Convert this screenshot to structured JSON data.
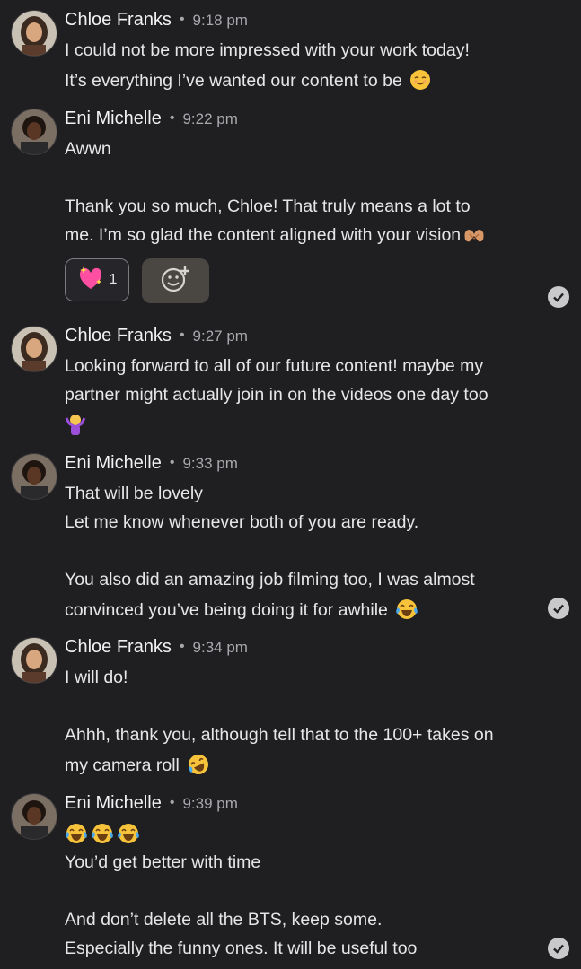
{
  "messages": [
    {
      "sender": "Chloe Franks",
      "time": "9:18 pm",
      "lines": [
        "I could not be more impressed with your work today!",
        "It’s everything I’ve wanted our content to be"
      ],
      "emoji": "relieved-face",
      "read": false
    },
    {
      "sender": "Eni Michelle",
      "time": "9:22 pm",
      "lines": [
        "Awwn",
        "",
        "Thank you so much, Chloe! That truly means a lot to",
        "me. I’m so glad the content aligned with your vision"
      ],
      "emoji": "heart-hands",
      "reaction": {
        "emoji": "sparkling-heart",
        "count": "1"
      },
      "read": true
    },
    {
      "sender": "Chloe Franks",
      "time": "9:27 pm",
      "lines": [
        "Looking forward to all of our future content! maybe my",
        "partner might actually join in on the videos one day too"
      ],
      "emoji": "person-shrugging",
      "read": false
    },
    {
      "sender": "Eni Michelle",
      "time": "9:33 pm",
      "lines": [
        "That will be lovely",
        "Let me know whenever both of you are ready.",
        "",
        "You also did an amazing job filming too, I was almost",
        "convinced you’ve being doing it for awhile"
      ],
      "emoji": "tears-of-joy",
      "read": true
    },
    {
      "sender": "Chloe Franks",
      "time": "9:34 pm",
      "lines": [
        "I will do!",
        "",
        "Ahhh, thank you, although tell that to the 100+ takes on",
        "my camera roll"
      ],
      "emoji": "rolling-on-floor-laughing",
      "read": false
    },
    {
      "sender": "Eni Michelle",
      "time": "9:39 pm",
      "lines": [
        "",
        "You’d get better with time",
        "",
        "And don’t delete all the BTS, keep some.",
        "Especially the funny ones. It will be useful too"
      ],
      "emoji": "tears-of-joy x3",
      "read": true
    }
  ],
  "separator": "•",
  "colors": {
    "background": "#1f1f22",
    "text": "#e9e9ea",
    "muted": "#a8a8ad"
  }
}
